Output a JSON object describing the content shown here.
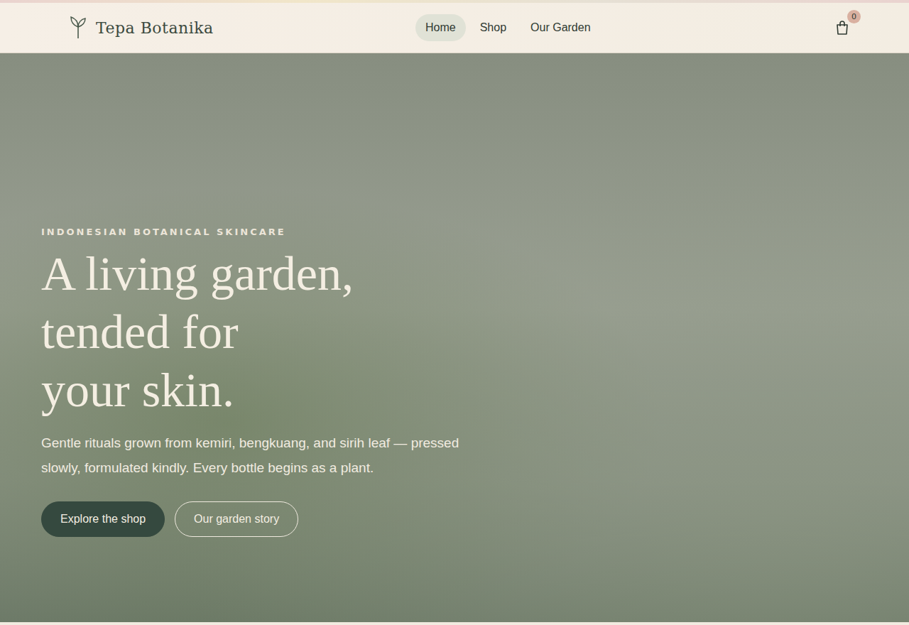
{
  "header": {
    "brand": "Tepa Botanika",
    "nav": [
      {
        "label": "Home",
        "selected": true
      },
      {
        "label": "Shop",
        "selected": false
      },
      {
        "label": "Our Garden",
        "selected": false
      }
    ],
    "cart_count": "0"
  },
  "hero": {
    "eyebrow": "INDONESIAN BOTANICAL SKINCARE",
    "title_lines": [
      "A living garden,",
      "tended for",
      "your skin."
    ],
    "body": "Gentle rituals grown from kemiri, bengkuang, and sirih leaf — pressed slowly, formulated kindly. Every bottle begins as a plant.",
    "buttons": [
      {
        "label": "Explore the shop",
        "kind": "primary"
      },
      {
        "label": "Our garden story",
        "kind": "outline"
      }
    ]
  }
}
